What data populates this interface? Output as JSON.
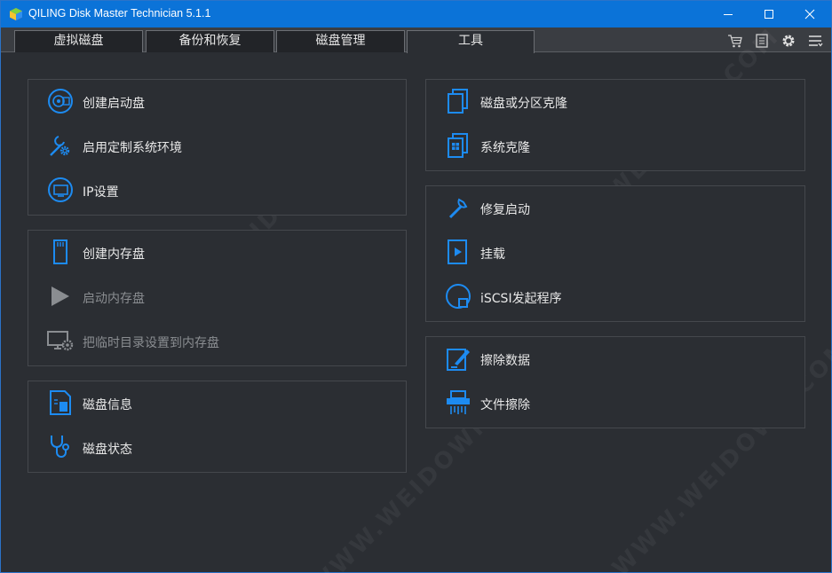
{
  "window": {
    "title": "QILING Disk Master Technician 5.1.1",
    "accent": "#0b73d8",
    "icon_color": "#1d8bf1"
  },
  "tabs": [
    {
      "label": "虚拟磁盘"
    },
    {
      "label": "备份和恢复"
    },
    {
      "label": "磁盘管理"
    },
    {
      "label": "工具",
      "active": true
    }
  ],
  "toolbar_icons": [
    "cart-icon",
    "list-icon",
    "gear-icon",
    "menu-icon"
  ],
  "left_panels": {
    "boot": [
      {
        "label": "创建启动盘",
        "icon": "disc-icon"
      },
      {
        "label": "启用定制系统环境",
        "icon": "tools-icon"
      },
      {
        "label": "IP设置",
        "icon": "network-icon"
      }
    ],
    "ramdisk": [
      {
        "label": "创建内存盘",
        "icon": "memory-card-icon"
      },
      {
        "label": "启动内存盘",
        "icon": "play-icon",
        "disabled": true
      },
      {
        "label": "把临时目录设置到内存盘",
        "icon": "monitor-gear-icon",
        "disabled": true
      }
    ],
    "disk": [
      {
        "label": "磁盘信息",
        "icon": "document-icon"
      },
      {
        "label": "磁盘状态",
        "icon": "stethoscope-icon"
      }
    ]
  },
  "right_panels": {
    "clone": [
      {
        "label": "磁盘或分区克隆",
        "icon": "copy-icon"
      },
      {
        "label": "系统克隆",
        "icon": "system-copy-icon"
      }
    ],
    "repair": [
      {
        "label": "修复启动",
        "icon": "wrench-icon"
      },
      {
        "label": "挂载",
        "icon": "mount-play-icon"
      },
      {
        "label": "iSCSI发起程序",
        "icon": "iscsi-icon"
      }
    ],
    "wipe": [
      {
        "label": "擦除数据",
        "icon": "erase-icon"
      },
      {
        "label": "文件擦除",
        "icon": "shredder-icon"
      }
    ]
  },
  "watermark": "WWW.WEIDOWN.COM"
}
